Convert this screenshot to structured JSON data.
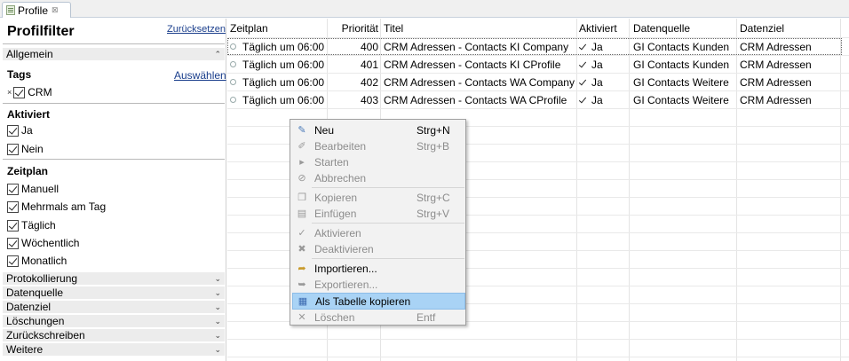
{
  "tab": {
    "label": "Profile",
    "close": "⊠"
  },
  "filter": {
    "title": "Profilfilter",
    "reset": "Zurücksetzen",
    "general": "Allgemein",
    "tags_header": "Tags",
    "choose": "Auswählen",
    "tag_remove": "×",
    "tag_value": "CRM",
    "activated_header": "Aktiviert",
    "activated": [
      "Ja",
      "Nein"
    ],
    "schedule_header": "Zeitplan",
    "schedule": [
      "Manuell",
      "Mehrmals am Tag",
      "Täglich",
      "Wöchentlich",
      "Monatlich"
    ],
    "collapsed": [
      "Protokollierung",
      "Datenquelle",
      "Datenziel",
      "Löschungen",
      "Zurückschreiben",
      "Weitere"
    ],
    "arrow_up": "⌃",
    "arrow_down": "⌄"
  },
  "table": {
    "columns": [
      "Zeitplan",
      "Priorität",
      "Titel",
      "Aktiviert",
      "Datenquelle",
      "Datenziel"
    ],
    "rows": [
      {
        "zeitplan": "Täglich um 06:00",
        "prio": "400",
        "titel": "CRM Adressen - Contacts KI Company",
        "aktiviert": "Ja",
        "quelle": "GI Contacts Kunden",
        "ziel": "CRM Adressen"
      },
      {
        "zeitplan": "Täglich um 06:00",
        "prio": "401",
        "titel": "CRM Adressen - Contacts KI CProfile",
        "aktiviert": "Ja",
        "quelle": "GI Contacts Kunden",
        "ziel": "CRM Adressen"
      },
      {
        "zeitplan": "Täglich um 06:00",
        "prio": "402",
        "titel": "CRM Adressen - Contacts WA Company",
        "aktiviert": "Ja",
        "quelle": "GI Contacts Weitere",
        "ziel": "CRM Adressen"
      },
      {
        "zeitplan": "Täglich um 06:00",
        "prio": "403",
        "titel": "CRM Adressen - Contacts WA CProfile",
        "aktiviert": "Ja",
        "quelle": "GI Contacts Weitere",
        "ziel": "CRM Adressen"
      }
    ]
  },
  "menu": {
    "items": [
      {
        "label": "Neu",
        "shortcut": "Strg+N"
      },
      {
        "label": "Bearbeiten",
        "shortcut": "Strg+B"
      },
      {
        "label": "Starten",
        "shortcut": ""
      },
      {
        "label": "Abbrechen",
        "shortcut": ""
      },
      {
        "label": "Kopieren",
        "shortcut": "Strg+C"
      },
      {
        "label": "Einfügen",
        "shortcut": "Strg+V"
      },
      {
        "label": "Aktivieren",
        "shortcut": ""
      },
      {
        "label": "Deaktivieren",
        "shortcut": ""
      },
      {
        "label": "Importieren...",
        "shortcut": ""
      },
      {
        "label": "Exportieren...",
        "shortcut": ""
      },
      {
        "label": "Als Tabelle kopieren",
        "shortcut": ""
      },
      {
        "label": "Löschen",
        "shortcut": "Entf"
      }
    ]
  },
  "colors": {
    "link": "#1a3e8c",
    "highlight": "#a9d3f5",
    "section_bg": "#ececec"
  }
}
